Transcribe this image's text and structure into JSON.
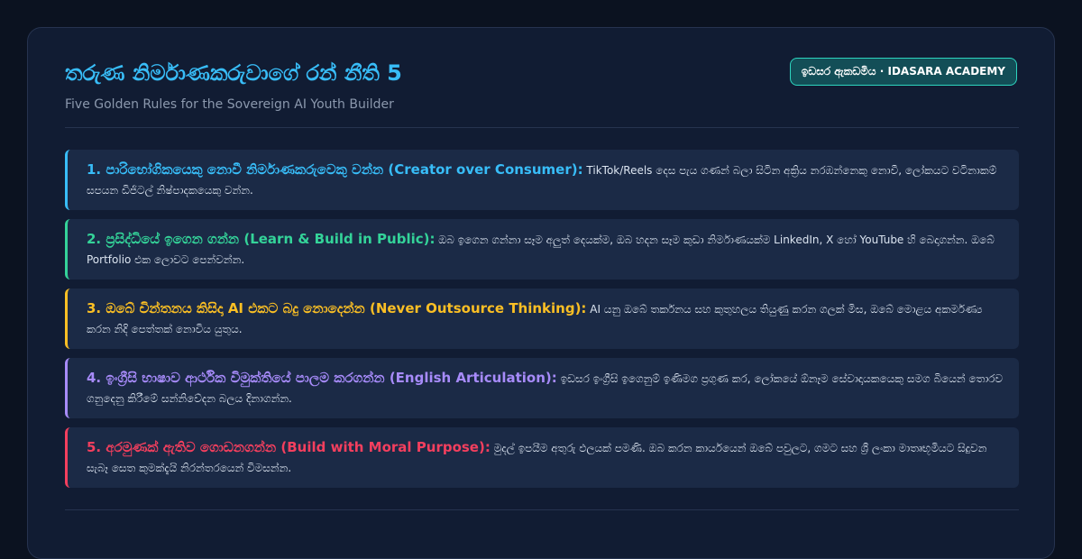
{
  "header": {
    "title": "තරුණ නිර්මාණකරුවාගේ රන් නීති 5",
    "subtitle": "Five Golden Rules for the Sovereign AI Youth Builder",
    "badge": "ඉඩසර ඇකඩමිය · IDASARA ACADEMY"
  },
  "colors": {
    "background": "#0b1220",
    "card": "#111c33",
    "rule_background": "#1b2a46",
    "title": "#38bdf8",
    "badge_border": "#2dd4bf"
  },
  "rules": [
    {
      "heading": "1. පාරිභෝගිකයෙකු නොවී නිර්මාණකරුවෙකු වන්න (Creator over Consumer):",
      "body": " TikTok/Reels දෙස පැය ගණන් බලා සිටින අක්‍රිය නරඹන්නෙකු නොවී, ලෝකයට වටිනාකම් සපයන ඩිජිටල් නිෂ්පාදකයෙකු වන්න.",
      "color": "#38bdf8"
    },
    {
      "heading": "2. ප්‍රසිද්ධියේ ඉගෙන ගන්න (Learn & Build in Public):",
      "body": " ඔබ ඉගෙන ගන්නා සෑම අලුත් දෙයක්ම, ඔබ හදන සෑම කුඩා නිර්මාණයක්ම LinkedIn, X හෝ YouTube හි බෙදාගන්න. ඔබේ Portfolio එක ලොවට පෙන්වන්න.",
      "color": "#34d399"
    },
    {
      "heading": "3. ඔබේ චින්තනය කිසිදා AI එකට බදු නොදෙන්න (Never Outsource Thinking):",
      "body": " AI යනු ඔබේ තර්කනය සහ කුතුහලය තියුණු කරන ගලක් මිස, ඔබේ මොළය අකර්මණ්‍ය කරන නිදි පෙත්තක් නොවිය යුතුය.",
      "color": "#fbbf24"
    },
    {
      "heading": "4. ඉංග්‍රීසි භාෂාව ආර්ථික විමුක්තියේ පාලම කරගන්න (English Articulation):",
      "body": " ඉඩසර ඉංග්‍රීසි ඉගෙනුම් ඉණිමග ප්‍රගුණ කර, ලෝකයේ ඕනෑම සේවාදායකයෙකු සමග බියෙන් තොරව ගනුදෙනු කිරීමේ සන්නිවේදන බලය දිනාගන්න.",
      "color": "#a78bfa"
    },
    {
      "heading": "5. අරමුණක් ඇතිව ගොඩනගන්න (Build with Moral Purpose):",
      "body": " මුදල් ඉපයීම අතුරු ඵලයක් පමණි. ඔබ කරන කාර්යයෙන් ඔබේ පවුලට, ගමට සහ ශ්‍රී ලංකා මාතෘභූමියට සිදුවන සැබෑ සෙත කුමක්දැයි නිරන්තරයෙන් විමසන්න.",
      "color": "#f43f5e"
    }
  ]
}
